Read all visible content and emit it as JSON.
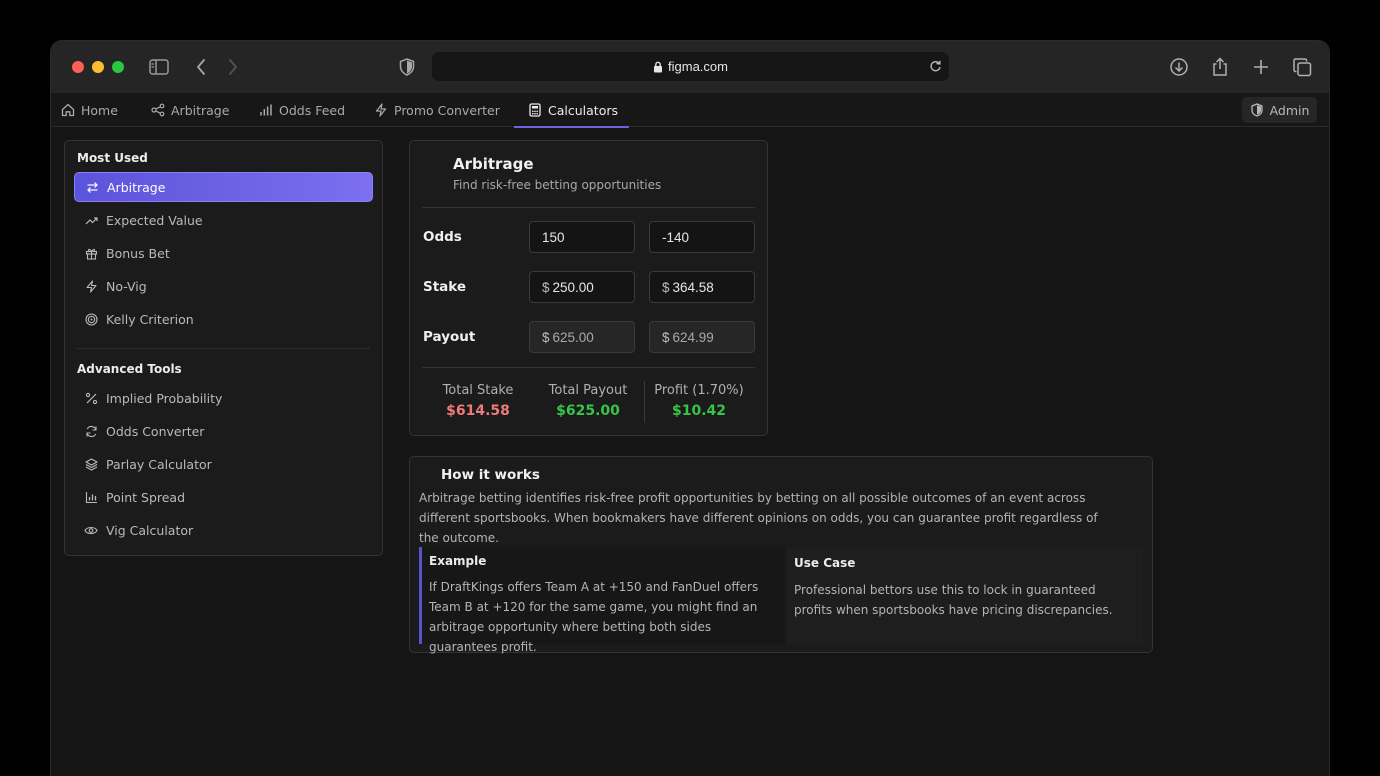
{
  "browser": {
    "url": "figma.com"
  },
  "nav": {
    "items": [
      {
        "label": "Home",
        "icon": "home-icon"
      },
      {
        "label": "Arbitrage",
        "icon": "network-icon"
      },
      {
        "label": "Odds Feed",
        "icon": "bar-chart-icon"
      },
      {
        "label": "Promo Converter",
        "icon": "zap-icon"
      },
      {
        "label": "Calculators",
        "icon": "calculator-icon",
        "active": true
      }
    ],
    "admin_label": "Admin"
  },
  "sidebar": {
    "most_used_heading": "Most Used",
    "most_used": [
      {
        "label": "Arbitrage",
        "icon": "swap-icon",
        "active": true
      },
      {
        "label": "Expected Value",
        "icon": "trending-up-icon"
      },
      {
        "label": "Bonus Bet",
        "icon": "gift-icon"
      },
      {
        "label": "No-Vig",
        "icon": "zap-icon"
      },
      {
        "label": "Kelly Criterion",
        "icon": "target-icon"
      }
    ],
    "advanced_heading": "Advanced Tools",
    "advanced": [
      {
        "label": "Implied Probability",
        "icon": "percent-icon"
      },
      {
        "label": "Odds Converter",
        "icon": "refresh-icon"
      },
      {
        "label": "Parlay Calculator",
        "icon": "layers-icon"
      },
      {
        "label": "Point Spread",
        "icon": "bar-chart-icon"
      },
      {
        "label": "Vig Calculator",
        "icon": "eye-icon"
      }
    ]
  },
  "calculator": {
    "title": "Arbitrage",
    "subtitle": "Find risk-free betting opportunities",
    "odds_label": "Odds",
    "stake_label": "Stake",
    "payout_label": "Payout",
    "currency": "$",
    "odds_a": "150",
    "odds_b": "-140",
    "stake_a": "250.00",
    "stake_b": "364.58",
    "payout_a": "625.00",
    "payout_b": "624.99",
    "totals": [
      {
        "label": "Total Stake",
        "value": "$614.58",
        "color": "#f07a7a"
      },
      {
        "label": "Total Payout",
        "value": "$625.00",
        "color": "#35c54a"
      },
      {
        "label": "Profit (1.70%)",
        "value": "$10.42",
        "color": "#35c54a"
      }
    ]
  },
  "how_it_works": {
    "title": "How it works",
    "text": "Arbitrage betting identifies risk-free profit opportunities by betting on all possible outcomes of an event across different sportsbooks. When bookmakers have different opinions on odds, you can guarantee profit regardless of the outcome.",
    "example_title": "Example",
    "example_text": "If DraftKings offers Team A at +150 and FanDuel offers Team B at +120 for the same game, you might find an arbitrage opportunity where betting both sides guarantees profit.",
    "usecase_title": "Use Case",
    "usecase_text": "Professional bettors use this to lock in guaranteed profits when sportsbooks have pricing discrepancies."
  },
  "colors": {
    "accent": "#6c63e0",
    "negative": "#f07a7a",
    "positive": "#35c54a"
  }
}
